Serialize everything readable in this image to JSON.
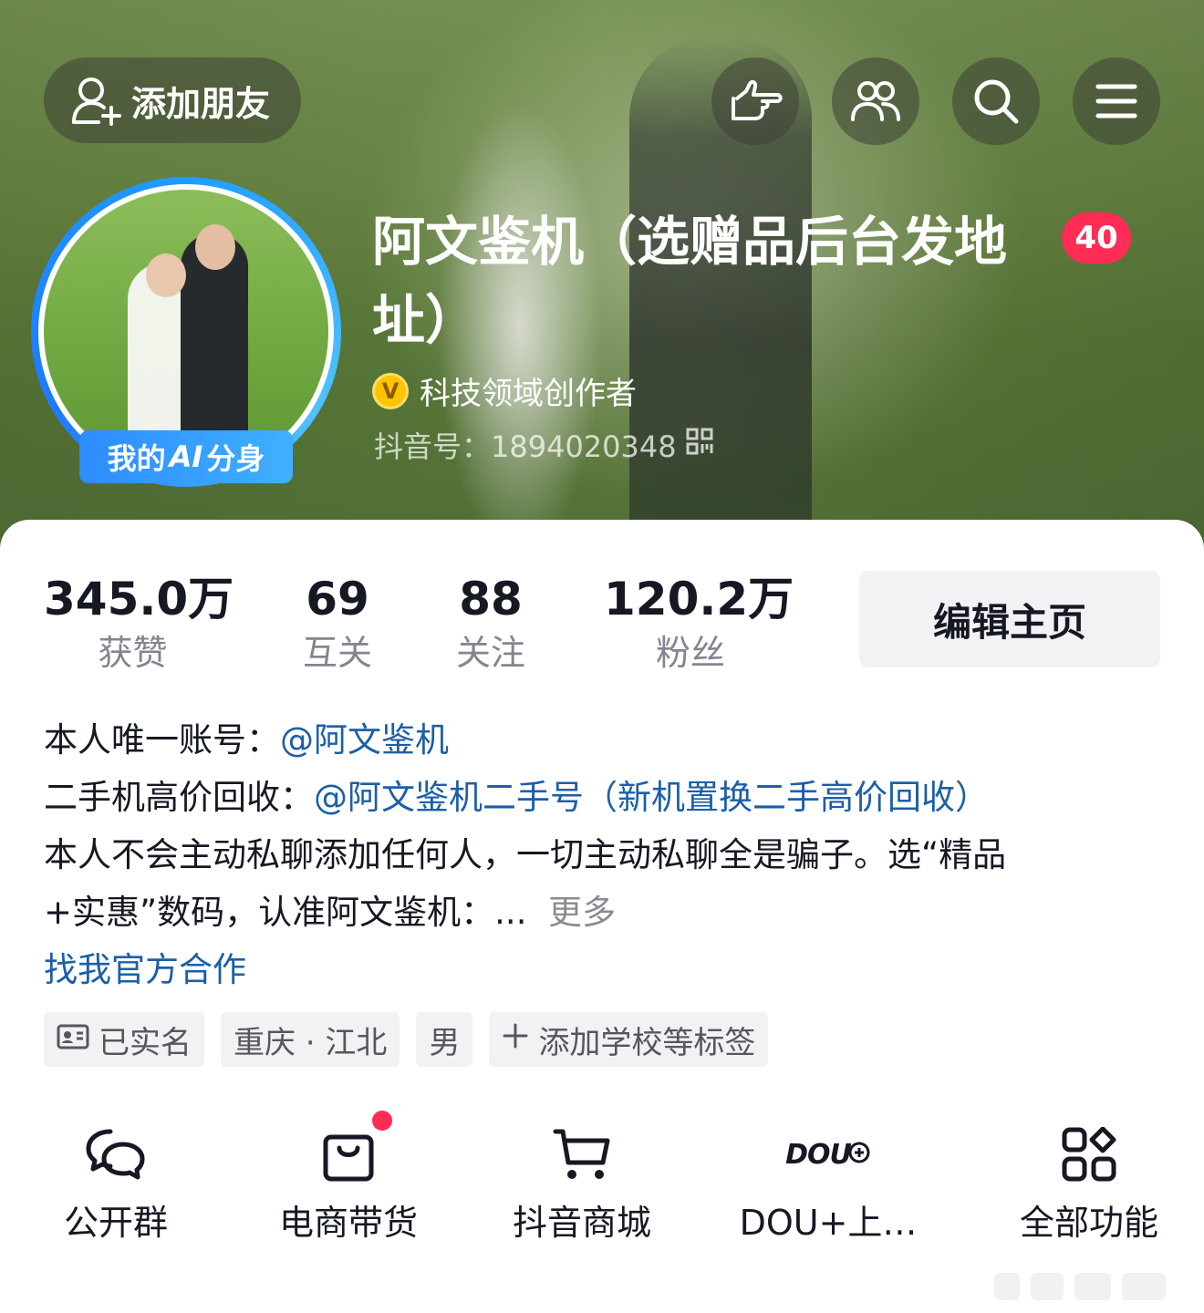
{
  "header": {
    "add_friend_label": "添加朋友",
    "icons": [
      "hand-point-icon",
      "friends-icon",
      "search-icon",
      "menu-icon"
    ]
  },
  "profile": {
    "nickname": "阿文鉴机（选赠品后台发地址）",
    "level_badge": "40",
    "ai_badge_prefix": "我的",
    "ai_badge_ai": "AI",
    "ai_badge_suffix": "分身",
    "certification": "科技领域创作者",
    "douyin_id": "抖音号：1894020348"
  },
  "stats": [
    {
      "value": "345.0万",
      "label": "获赞"
    },
    {
      "value": "69",
      "label": "互关"
    },
    {
      "value": "88",
      "label": "关注"
    },
    {
      "value": "120.2万",
      "label": "粉丝"
    }
  ],
  "edit_button": "编辑主页",
  "bio": {
    "line1_prefix": "本人唯一账号：",
    "line1_link": "@阿文鉴机",
    "line2_prefix": "二手机高价回收：",
    "line2_link": "@阿文鉴机二手号（新机置换二手高价回收）",
    "line3": "本人不会主动私聊添加任何人，一切主动私聊全是骗子。选“精品",
    "line4": "+实惠”数码，认准阿文鉴机：...",
    "more": "更多",
    "official": "找我官方合作"
  },
  "tags": [
    "已实名",
    "重庆 · 江北",
    "男",
    "添加学校等标签"
  ],
  "functions": [
    {
      "label": "公开群",
      "icon": "chat-bubbles-icon"
    },
    {
      "label": "电商带货",
      "icon": "shopping-bag-icon"
    },
    {
      "label": "抖音商城",
      "icon": "cart-icon"
    },
    {
      "label": "DOU+上…",
      "icon": "dou-plus-icon",
      "icon_text": "DOU"
    },
    {
      "label": "全部功能",
      "icon": "grid-icon"
    }
  ],
  "colors": {
    "accent_red": "#ff2c55",
    "link_blue": "#1b5fa8",
    "ai_blue": "#2d8cff",
    "cert_gold": "#ffc400"
  }
}
